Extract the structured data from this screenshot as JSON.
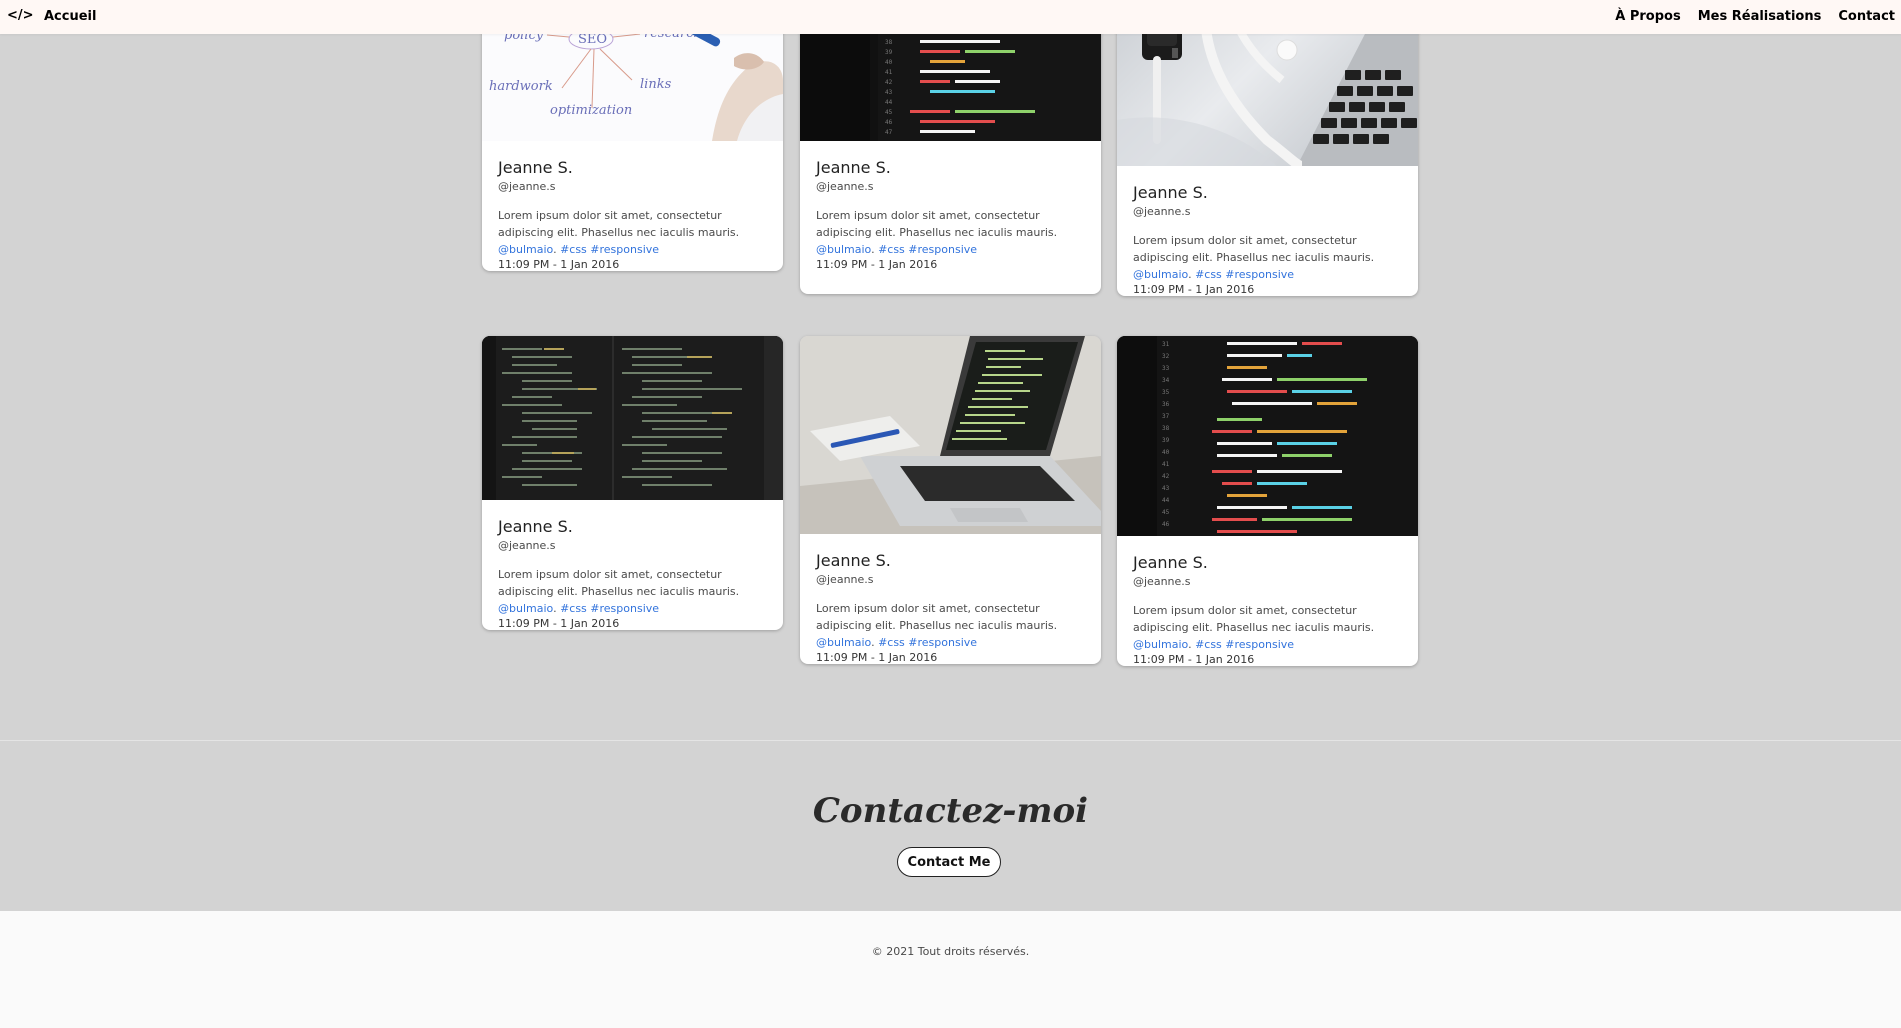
{
  "nav": {
    "brand": "</>",
    "home": "Accueil",
    "links": [
      "À Propos",
      "Mes Réalisations",
      "Contact"
    ]
  },
  "cards": [
    {
      "image": "seo-mindmap",
      "name": "Jeanne S.",
      "handle": "@jeanne.s",
      "text": "Lorem ipsum dolor sit amet, consectetur adipiscing elit. Phasellus nec iaculis mauris.",
      "mention": "@bulmaio",
      "tag1": "#css",
      "tag2": "#responsive",
      "time": "11:09 PM - 1 Jan 2016"
    },
    {
      "image": "code-screen",
      "name": "Jeanne S.",
      "handle": "@jeanne.s",
      "text": "Lorem ipsum dolor sit amet, consectetur adipiscing elit. Phasellus nec iaculis mauris.",
      "mention": "@bulmaio",
      "tag1": "#css",
      "tag2": "#responsive",
      "time": "11:09 PM - 1 Jan 2016"
    },
    {
      "image": "smartwatch-laptop",
      "name": "Jeanne S.",
      "handle": "@jeanne.s",
      "text": "Lorem ipsum dolor sit amet, consectetur adipiscing elit. Phasellus nec iaculis mauris.",
      "mention": "@bulmaio",
      "tag1": "#css",
      "tag2": "#responsive",
      "time": "11:09 PM - 1 Jan 2016"
    },
    {
      "image": "dark-code-editor",
      "name": "Jeanne S.",
      "handle": "@jeanne.s",
      "text": "Lorem ipsum dolor sit amet, consectetur adipiscing elit. Phasellus nec iaculis mauris.",
      "mention": "@bulmaio",
      "tag1": "#css",
      "tag2": "#responsive",
      "time": "11:09 PM - 1 Jan 2016"
    },
    {
      "image": "laptop-desk",
      "name": "Jeanne S.",
      "handle": "@jeanne.s",
      "text": "Lorem ipsum dolor sit amet, consectetur adipiscing elit. Phasellus nec iaculis mauris.",
      "mention": "@bulmaio",
      "tag1": "#css",
      "tag2": "#responsive",
      "time": "11:09 PM - 1 Jan 2016"
    },
    {
      "image": "code-screen",
      "name": "Jeanne S.",
      "handle": "@jeanne.s",
      "text": "Lorem ipsum dolor sit amet, consectetur adipiscing elit. Phasellus nec iaculis mauris.",
      "mention": "@bulmaio",
      "tag1": "#css",
      "tag2": "#responsive",
      "time": "11:09 PM - 1 Jan 2016"
    }
  ],
  "seo_words": [
    "policy",
    "SEO",
    "research",
    "hardwork",
    "links",
    "optimization"
  ],
  "contact": {
    "title": "Contactez-moi",
    "button": "Contact Me"
  },
  "footer": {
    "copyright": "© 2021 Tout droits réservés."
  },
  "colors": {
    "link": "#3273dc",
    "background": "#d3d3d3",
    "navbar": "#fff8f5"
  }
}
